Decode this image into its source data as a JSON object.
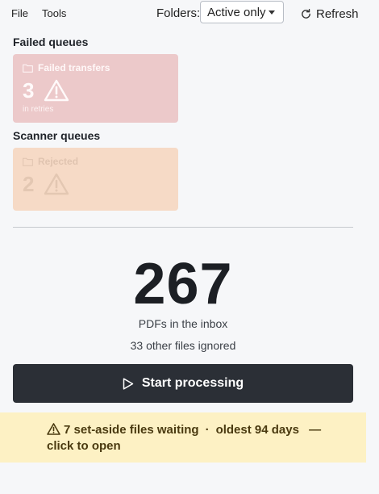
{
  "menu": {
    "file": "File",
    "tools": "Tools"
  },
  "folders": {
    "label": "Folders:",
    "selected": "Active only"
  },
  "refresh_label": "Refresh",
  "failed_section": {
    "title": "Failed queues",
    "card": {
      "name": "Failed transfers",
      "count": "3",
      "sub": "in retries"
    }
  },
  "scanner_section": {
    "title": "Scanner queues",
    "card": {
      "name": "Rejected",
      "count": "2"
    }
  },
  "inbox": {
    "count": "267",
    "label": "PDFs in the inbox",
    "ignored": "33 other files ignored"
  },
  "start_button": "Start processing",
  "banner": {
    "waiting": "7 set-aside files waiting",
    "separator": "·",
    "oldest": "oldest 94 days",
    "dash": "—",
    "action": "click to open"
  },
  "colors": {
    "failed_card": "#ecc9ca",
    "rejected_card": "#f6dac6",
    "start_button": "#2b2f36",
    "banner": "#fdf1c4"
  }
}
